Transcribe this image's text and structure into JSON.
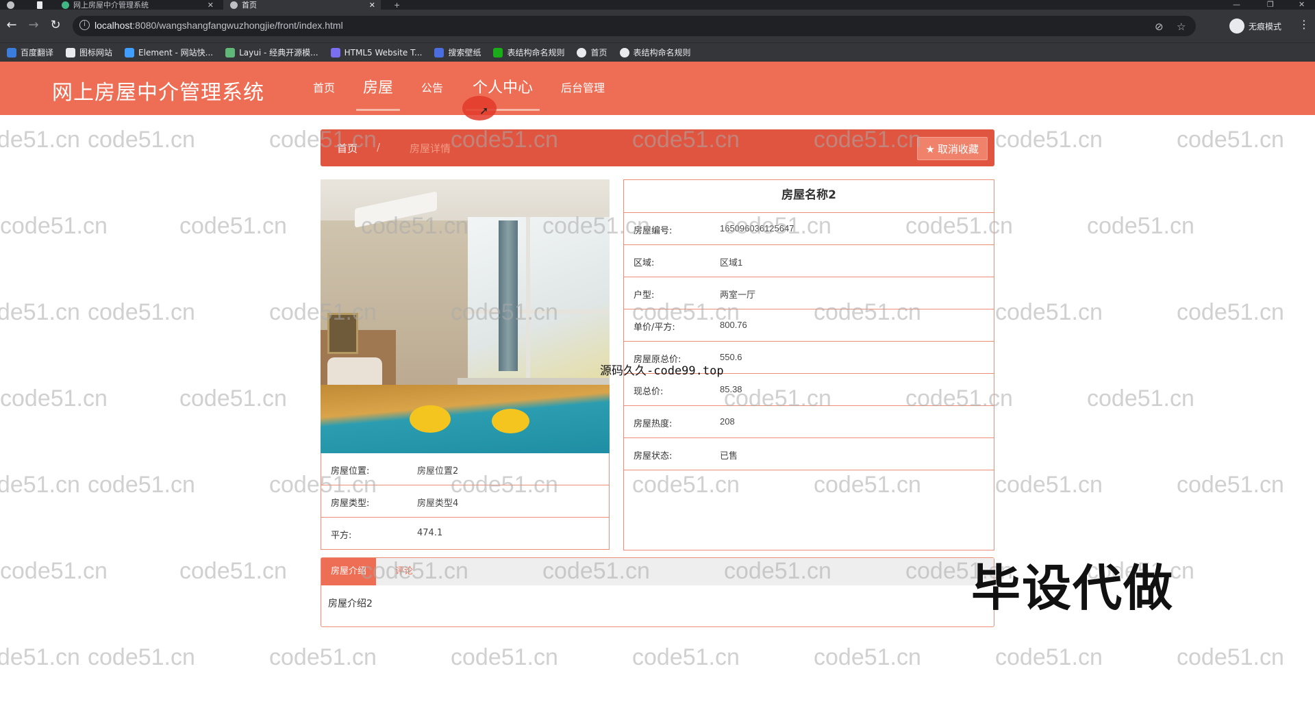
{
  "browser": {
    "tabs": [
      {
        "title": "网上房屋中介管理系统"
      },
      {
        "title": "首页"
      }
    ],
    "url_host": "localhost",
    "url_rest": ":8080/wangshangfangwuzhongjie/front/index.html",
    "incognito_label": "无痕模式",
    "bookmarks": [
      {
        "label": "百度翻译",
        "color": "#3b7ddd"
      },
      {
        "label": "图标网站",
        "color": "#e8eaed"
      },
      {
        "label": "Element - 网站快...",
        "color": "#3f9eff"
      },
      {
        "label": "Layui - 经典开源模...",
        "color": "#5fb878"
      },
      {
        "label": "HTML5 Website T...",
        "color": "#7a6ff0"
      },
      {
        "label": "搜索壁纸",
        "color": "#4a6ee0"
      },
      {
        "label": "表结构命名规则",
        "color": "#1aad19"
      },
      {
        "label": "首页",
        "color": "#e8eaed"
      },
      {
        "label": "表结构命名规则",
        "color": "#e8eaed"
      }
    ]
  },
  "header": {
    "brand": "网上房屋中介管理系统",
    "nav": {
      "home": "首页",
      "house": "房屋",
      "notice": "公告",
      "personal": "个人中心",
      "admin": "后台管理"
    }
  },
  "breadcrumb": {
    "home": "首页",
    "separator": "/",
    "current": "房屋详情",
    "fav_button": "取消收藏"
  },
  "house_left": [
    {
      "label": "房屋位置:",
      "value": "房屋位置2"
    },
    {
      "label": "房屋类型:",
      "value": "房屋类型4"
    },
    {
      "label": "平方:",
      "value": "474.1"
    }
  ],
  "house_detail": {
    "title": "房屋名称2",
    "rows": [
      {
        "label": "房屋编号:",
        "value": "1650960361256​47"
      },
      {
        "label": "区域:",
        "value": "区域1"
      },
      {
        "label": "户型:",
        "value": "两室一厅"
      },
      {
        "label": "单价/平方:",
        "value": "800.76"
      },
      {
        "label": "房屋原总价:",
        "value": "550.6"
      },
      {
        "label": "现总价:",
        "value": "85.38"
      },
      {
        "label": "房屋热度:",
        "value": "208"
      },
      {
        "label": "房屋状态:",
        "value": "已售"
      }
    ]
  },
  "tabs": {
    "intro_tab": "房屋介绍",
    "comment_tab": "评论",
    "content": "房屋介绍2"
  },
  "overlays": {
    "source_text": "源码久久-code99.top",
    "promo": "毕设代做",
    "watermark": "code51.cn"
  }
}
